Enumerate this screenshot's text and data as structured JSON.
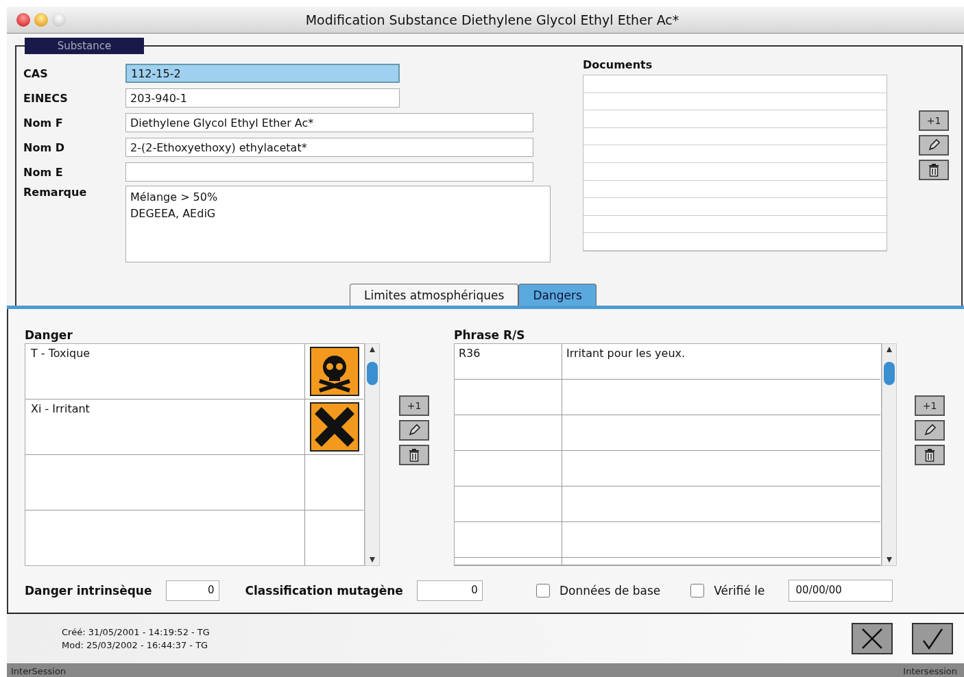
{
  "window": {
    "title": "Modification Substance Diethylene Glycol Ethyl Ether Ac*"
  },
  "substance": {
    "legend": "Substance",
    "fields": [
      {
        "label": "CAS",
        "value": "112-15-2",
        "focused": true,
        "kind": "short"
      },
      {
        "label": "EINECS",
        "value": "203-940-1",
        "focused": false,
        "kind": "short"
      },
      {
        "label": "Nom F",
        "value": "Diethylene Glycol Ethyl Ether Ac*",
        "focused": false,
        "kind": "long"
      },
      {
        "label": "Nom D",
        "value": "2-(2-Ethoxyethoxy) ethylacetat*",
        "focused": false,
        "kind": "long"
      },
      {
        "label": "Nom E",
        "focused": false,
        "kind": "long"
      }
    ],
    "remark": {
      "label": "Remarque",
      "lines": [
        "Mélange > 50%",
        "DEGEEA, AEdiG"
      ]
    }
  },
  "documents": {
    "label": "Documents",
    "add_button": "+1"
  },
  "tabs": [
    {
      "label": "Limites atmosphériques",
      "selected": false
    },
    {
      "label": "Dangers",
      "selected": true
    }
  ],
  "danger": {
    "label": "Danger",
    "add_button": "+1",
    "rows": [
      {
        "name": "T - Toxique",
        "kind": "skull"
      },
      {
        "name": "Xi - Irritant",
        "kind": "cross"
      }
    ]
  },
  "phrases": {
    "label": "Phrase R/S",
    "add_button": "+1",
    "rows": [
      {
        "code": "R36",
        "text": "Irritant pour les yeux."
      }
    ]
  },
  "bottom": {
    "intrinsic": {
      "label": "Danger intrinsèque",
      "value": "0"
    },
    "mutagen": {
      "label": "Classification mutagène",
      "value": "0"
    },
    "base_data": {
      "label": "Données de base",
      "checked": false
    },
    "verified": {
      "label": "Vérifié le",
      "checked": false,
      "value": "00/00/00"
    }
  },
  "footer": {
    "created": "Créé: 31/05/2001 - 14:19:52 - TG",
    "modified": "Mod: 25/03/2002 - 16:44:37 - TG"
  },
  "status_bar": {
    "left": "InterSession",
    "right": "Intersession"
  }
}
